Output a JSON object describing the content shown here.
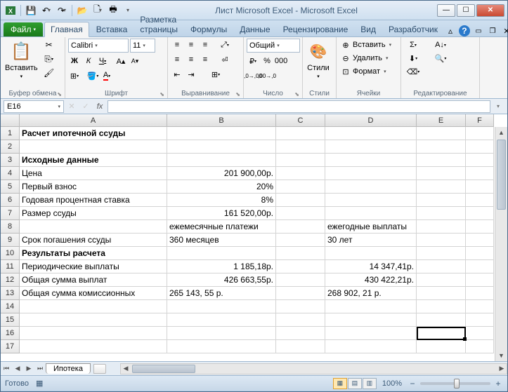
{
  "title": "Лист Microsoft Excel  -  Microsoft Excel",
  "file_tab": "Файл",
  "tabs": [
    "Главная",
    "Вставка",
    "Разметка страницы",
    "Формулы",
    "Данные",
    "Рецензирование",
    "Вид",
    "Разработчик"
  ],
  "ribbon": {
    "clipboard": {
      "label": "Буфер обмена",
      "paste": "Вставить"
    },
    "font": {
      "label": "Шрифт",
      "name": "Calibri",
      "size": "11"
    },
    "align": {
      "label": "Выравнивание"
    },
    "number": {
      "label": "Число",
      "format": "Общий"
    },
    "styles": {
      "label": "Стили",
      "btn": "Стили"
    },
    "cells": {
      "label": "Ячейки",
      "insert": "Вставить",
      "delete": "Удалить",
      "format": "Формат"
    },
    "editing": {
      "label": "Редактирование"
    }
  },
  "namebox": "E16",
  "columns": [
    "A",
    "B",
    "C",
    "D",
    "E",
    "F"
  ],
  "rows": [
    1,
    2,
    3,
    4,
    5,
    6,
    7,
    8,
    9,
    10,
    11,
    12,
    13,
    14,
    15,
    16,
    17
  ],
  "cells": {
    "r1": {
      "A": "Расчет ипотечной ссуды"
    },
    "r3": {
      "A": "Исходные данные"
    },
    "r4": {
      "A": "Цена",
      "B": "201 900,00р."
    },
    "r5": {
      "A": "Первый взнос",
      "B": "20%"
    },
    "r6": {
      "A": "Годовая процентная ставка",
      "B": "8%"
    },
    "r7": {
      "A": "Размер ссуды",
      "B": "161 520,00р."
    },
    "r8": {
      "B": "ежемесячные платежи",
      "D": "ежегодные выплаты"
    },
    "r9": {
      "A": "Срок погашения ссуды",
      "B": "360 месяцев",
      "D": "30 лет"
    },
    "r10": {
      "A": "Результаты расчета"
    },
    "r11": {
      "A": "Периодические выплаты",
      "B": "1 185,18р.",
      "D": "14 347,41р."
    },
    "r12": {
      "A": "Общая сумма выплат",
      "B": "426 663,55р.",
      "D": "430 422,21р."
    },
    "r13": {
      "A": "Общая сумма комиссионных",
      "B": "265 143, 55 р.",
      "D": "268 902, 21 р."
    }
  },
  "chart_data": {
    "type": "table",
    "title": "Расчет ипотечной ссуды",
    "inputs": {
      "Цена": "201 900,00р.",
      "Первый взнос": "20%",
      "Годовая процентная ставка": "8%",
      "Размер ссуды": "161 520,00р."
    },
    "scenarios": {
      "ежемесячные платежи": {
        "Срок погашения ссуды": "360 месяцев",
        "Периодические выплаты": "1 185,18р.",
        "Общая сумма выплат": "426 663,55р.",
        "Общая сумма комиссионных": "265 143, 55 р."
      },
      "ежегодные выплаты": {
        "Срок погашения ссуды": "30 лет",
        "Периодические выплаты": "14 347,41р.",
        "Общая сумма выплат": "430 422,21р.",
        "Общая сумма комиссионных": "268 902, 21 р."
      }
    }
  },
  "sheet": "Ипотека",
  "status": "Готово",
  "zoom": "100%",
  "macro_icon_tooltip": ""
}
